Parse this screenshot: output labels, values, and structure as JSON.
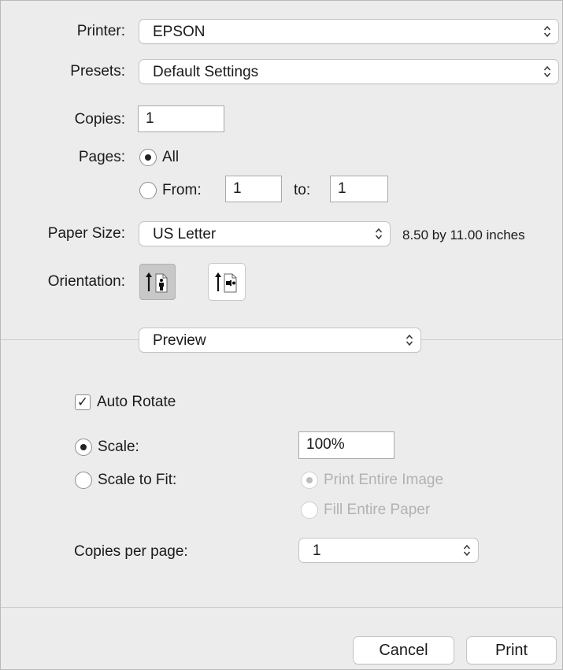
{
  "printer": {
    "label": "Printer:",
    "value": "EPSON"
  },
  "presets": {
    "label": "Presets:",
    "value": "Default Settings"
  },
  "copies": {
    "label": "Copies:",
    "value": "1"
  },
  "pages": {
    "label": "Pages:",
    "all_label": "All",
    "from_label": "From:",
    "from_value": "1",
    "to_label": "to:",
    "to_value": "1",
    "selected": "All"
  },
  "paper_size": {
    "label": "Paper Size:",
    "value": "US Letter",
    "dimensions": "8.50 by 11.00 inches"
  },
  "orientation": {
    "label": "Orientation:",
    "selected": "portrait"
  },
  "section_menu": {
    "value": "Preview"
  },
  "preview": {
    "auto_rotate_label": "Auto Rotate",
    "auto_rotate_checked": true,
    "check_glyph": "✓",
    "scale_label": "Scale:",
    "scale_value": "100%",
    "scale_to_fit_label": "Scale to Fit:",
    "print_entire_image_label": "Print Entire Image",
    "fill_entire_paper_label": "Fill Entire Paper",
    "copies_per_page_label": "Copies per page:",
    "copies_per_page_value": "1"
  },
  "buttons": {
    "cancel": "Cancel",
    "print": "Print"
  },
  "colors": {
    "window_bg": "#ececec",
    "control_bg": "#ffffff",
    "disabled_text": "#b2b2b2",
    "selected_orientation_bg": "#c8c8c8"
  }
}
